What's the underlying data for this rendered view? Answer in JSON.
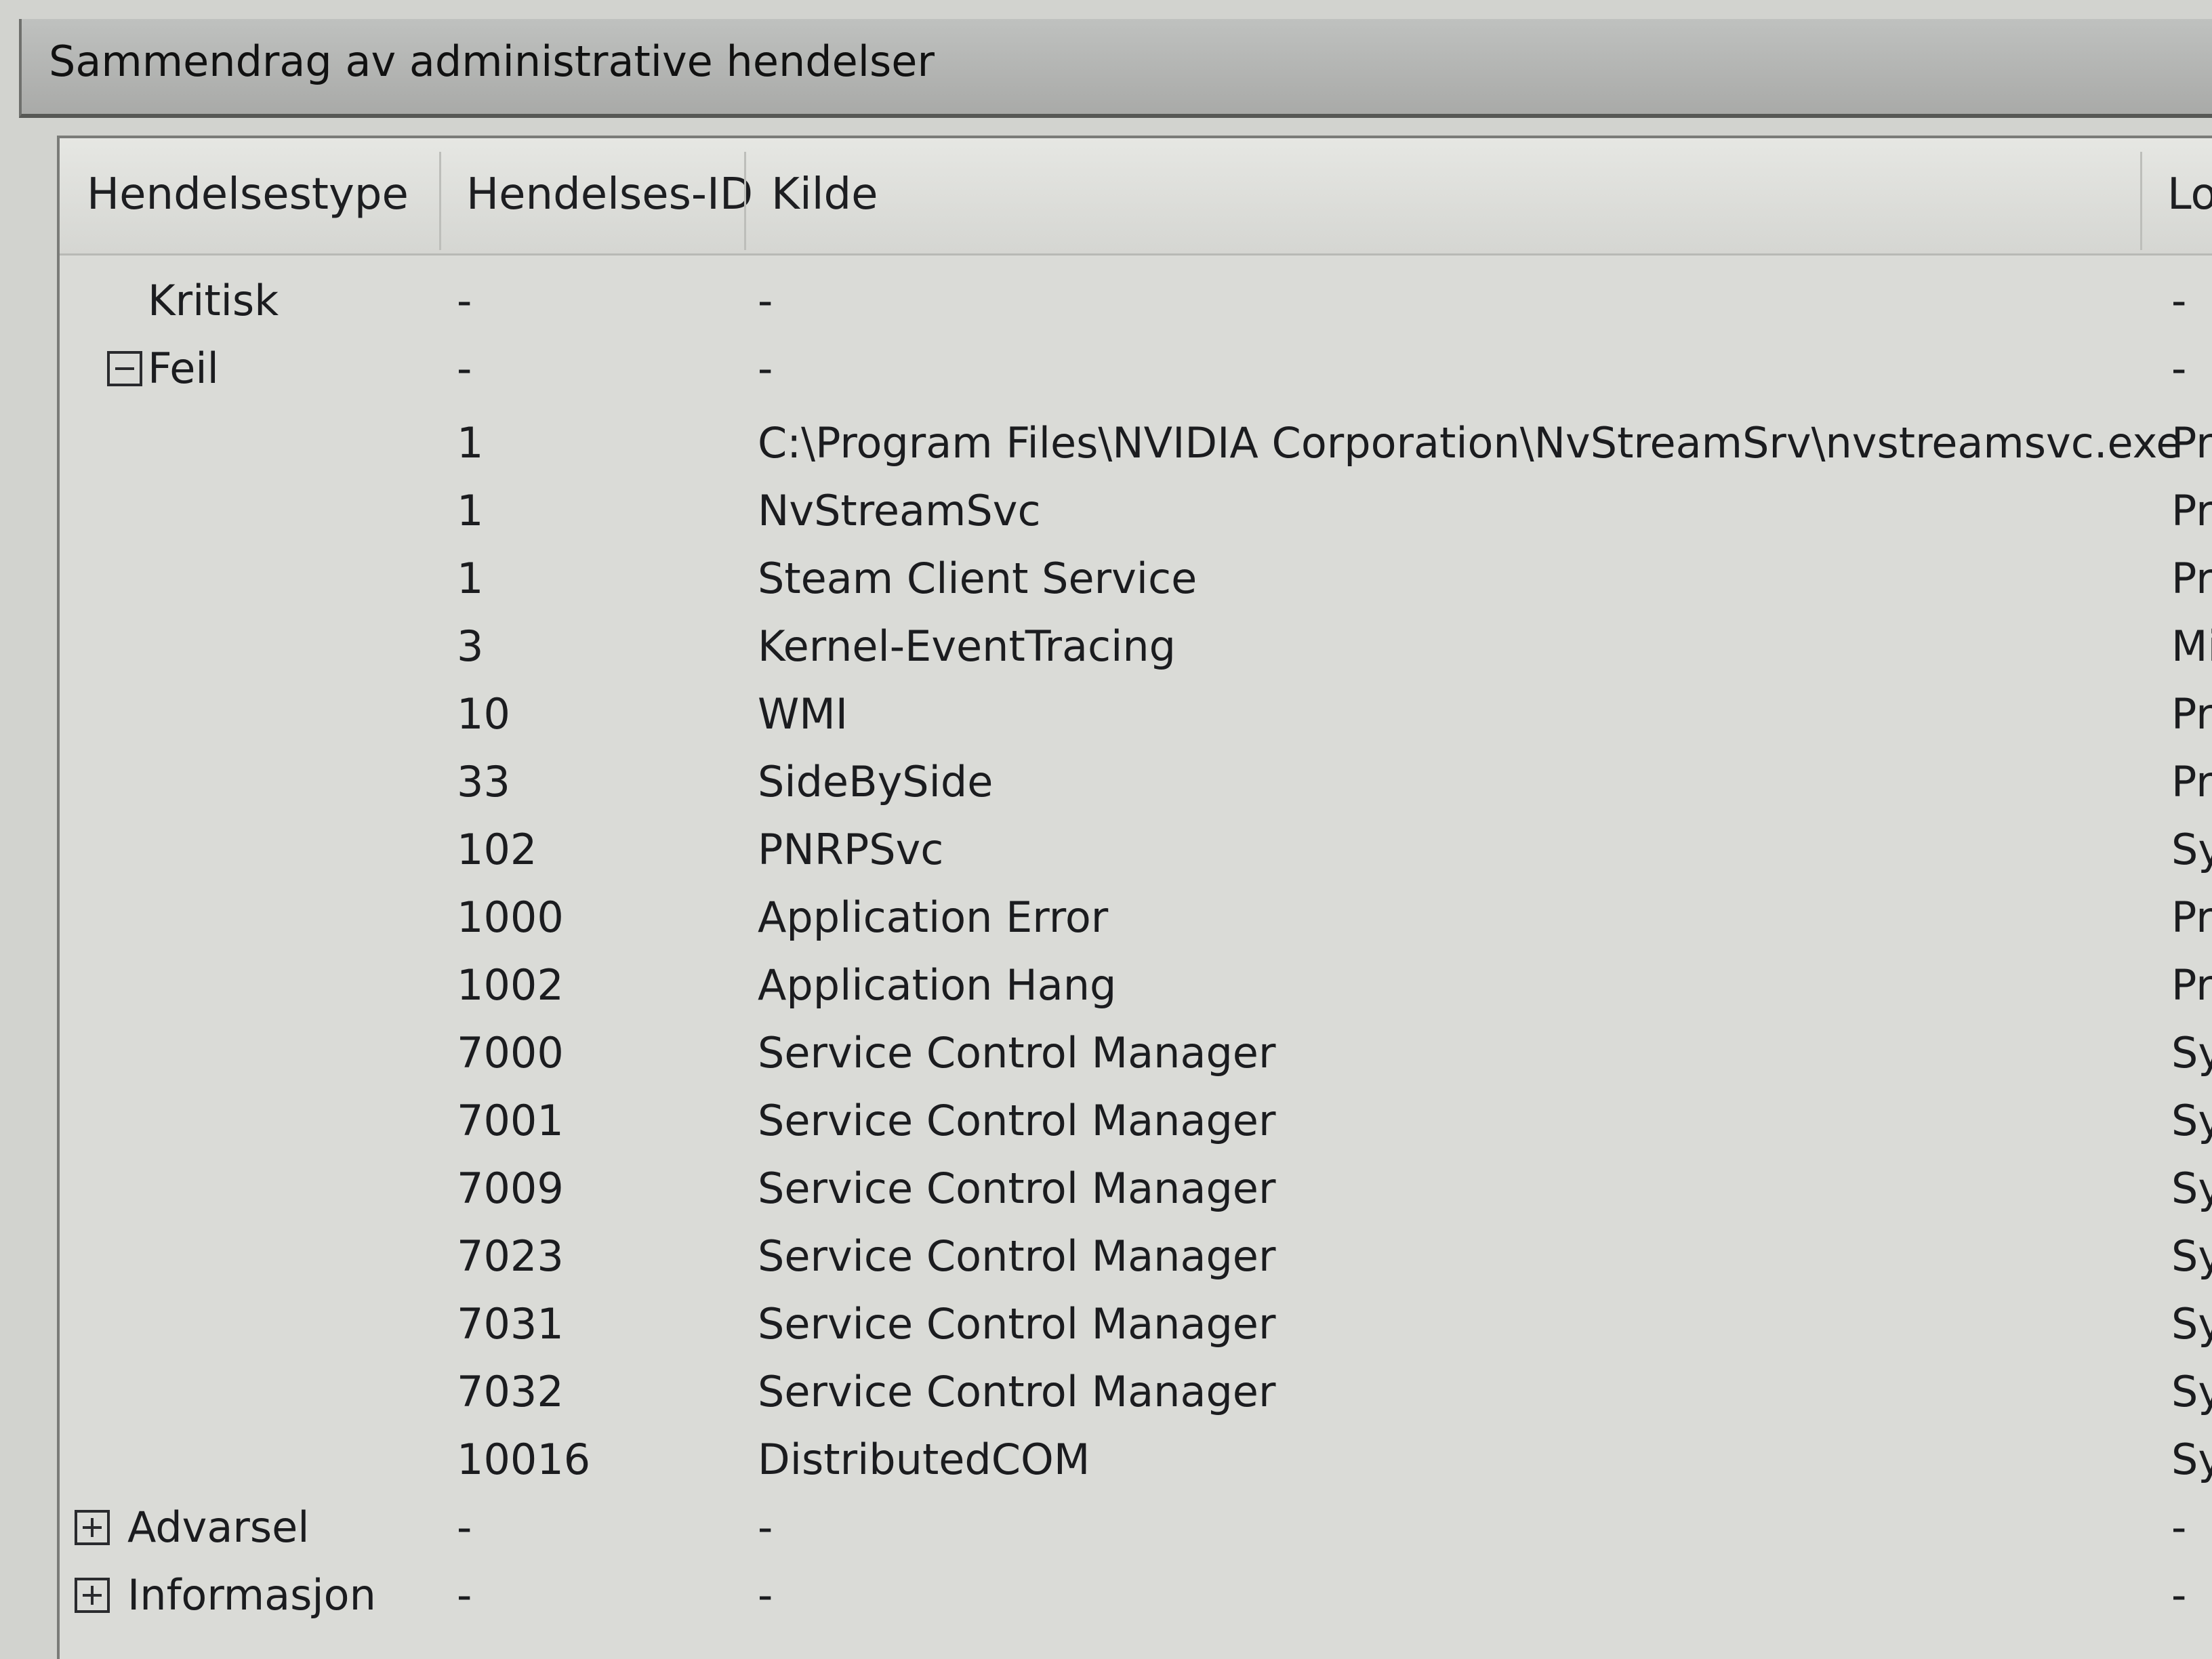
{
  "window": {
    "title": "Sammendrag av administrative hendelser"
  },
  "table": {
    "columns": {
      "type": "Hendelsestype",
      "id": "Hendelses-ID",
      "source": "Kilde",
      "log": "Lo"
    },
    "rows": [
      {
        "type": "Kritisk",
        "id": "-",
        "source": "-",
        "log": "-"
      },
      {
        "type": "Feil",
        "id": "-",
        "source": "-",
        "log": "-"
      },
      {
        "type": "",
        "id": "1",
        "source": "C:\\Program Files\\NVIDIA Corporation\\NvStreamSrv\\nvstreamsvc.exe",
        "log": "Pro"
      },
      {
        "type": "",
        "id": "1",
        "source": "NvStreamSvc",
        "log": "Pro"
      },
      {
        "type": "",
        "id": "1",
        "source": "Steam Client Service",
        "log": "Pro"
      },
      {
        "type": "",
        "id": "3",
        "source": "Kernel-EventTracing",
        "log": "Mi"
      },
      {
        "type": "",
        "id": "10",
        "source": "WMI",
        "log": "Pro"
      },
      {
        "type": "",
        "id": "33",
        "source": "SideBySide",
        "log": "Pro"
      },
      {
        "type": "",
        "id": "102",
        "source": "PNRPSvc",
        "log": "Sys"
      },
      {
        "type": "",
        "id": "1000",
        "source": "Application Error",
        "log": "Pro"
      },
      {
        "type": "",
        "id": "1002",
        "source": "Application Hang",
        "log": "Pro"
      },
      {
        "type": "",
        "id": "7000",
        "source": "Service Control Manager",
        "log": "Sys"
      },
      {
        "type": "",
        "id": "7001",
        "source": "Service Control Manager",
        "log": "Sys"
      },
      {
        "type": "",
        "id": "7009",
        "source": "Service Control Manager",
        "log": "Sys"
      },
      {
        "type": "",
        "id": "7023",
        "source": "Service Control Manager",
        "log": "Syst"
      },
      {
        "type": "",
        "id": "7031",
        "source": "Service Control Manager",
        "log": "Syst"
      },
      {
        "type": "",
        "id": "7032",
        "source": "Service Control Manager",
        "log": "Syst"
      },
      {
        "type": "",
        "id": "10016",
        "source": "DistributedCOM",
        "log": "Syst"
      },
      {
        "type": "Advarsel",
        "id": "-",
        "source": "-",
        "log": "-"
      },
      {
        "type": "Informasjon",
        "id": "-",
        "source": "-",
        "log": "-"
      }
    ]
  }
}
